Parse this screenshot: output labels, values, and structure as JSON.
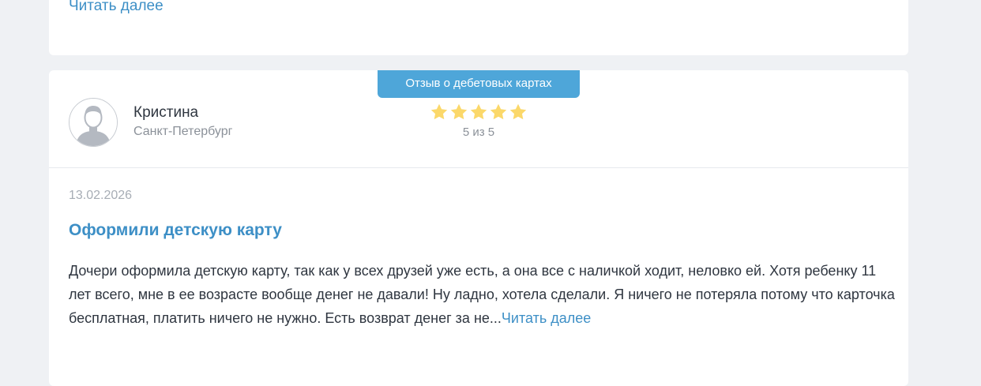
{
  "previous_review": {
    "read_more": "Читать далее"
  },
  "review": {
    "category_badge": "Отзыв о дебетовых картах",
    "author": {
      "name": "Кристина",
      "city": "Санкт-Петербург",
      "avatar_icon": "user-avatar-icon"
    },
    "rating": {
      "value": 5,
      "max": 5,
      "text": "5 из 5",
      "star_color": "#fbd86a"
    },
    "date": "13.02.2026",
    "title": "Оформили детскую карту",
    "text": "Дочери оформила детскую карту, так как у всех друзей уже есть, а она все с наличкой ходит, неловко ей. Хотя ребенку 11 лет всего, мне в ее возрасте вообще денег не давали! Ну ладно, хотела сделали. Я ничего не потеряла потому что карточка бесплатная, платить ничего не нужно. Есть возврат денег за не...",
    "read_more": "Читать далее"
  },
  "colors": {
    "accent": "#3d8fc6",
    "badge": "#4ea6d9",
    "background": "#eff1f4"
  }
}
